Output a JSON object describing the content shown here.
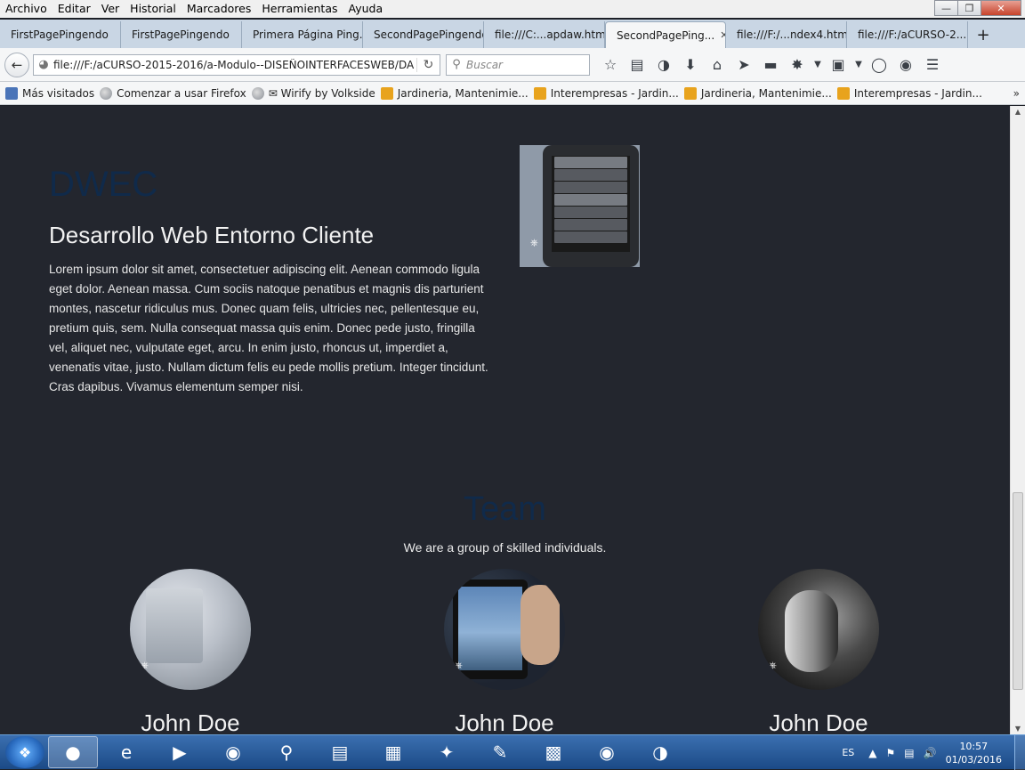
{
  "menubar": {
    "items": [
      "Archivo",
      "Editar",
      "Ver",
      "Historial",
      "Marcadores",
      "Herramientas",
      "Ayuda"
    ]
  },
  "tabs": [
    {
      "label": "FirstPagePingendo",
      "active": false
    },
    {
      "label": "FirstPagePingendo",
      "active": false
    },
    {
      "label": "Primera Página Ping...",
      "active": false
    },
    {
      "label": "SecondPagePingendo",
      "active": false
    },
    {
      "label": "file:///C:...apdaw.html",
      "active": false
    },
    {
      "label": "SecondPagePing...",
      "active": true
    },
    {
      "label": "file:///F:/...ndex4.html",
      "active": false
    },
    {
      "label": "file:///F:/aCURSO-2...",
      "active": false
    }
  ],
  "navbar": {
    "url": "file:///F:/aCURSO-2015-2016/a-Modulo--DISEÑOINTERFACESWEB/DA",
    "search_placeholder": "Buscar"
  },
  "bookmarks": [
    {
      "label": "Más visitados",
      "icon": "star"
    },
    {
      "label": "Comenzar a usar Firefox",
      "icon": "glob"
    },
    {
      "label": "✉ Wirify by Volkside",
      "icon": "glob"
    },
    {
      "label": "Jardineria, Mantenimie...",
      "icon": "rss"
    },
    {
      "label": "Interempresas - Jardin...",
      "icon": "rss"
    },
    {
      "label": "Jardineria, Mantenimie...",
      "icon": "rss"
    },
    {
      "label": "Interempresas - Jardin...",
      "icon": "rss"
    }
  ],
  "content": {
    "dwec_title": "DWEC",
    "dwec_subtitle": "Desarrollo Web Entorno Cliente",
    "dwec_body": "Lorem ipsum dolor sit amet, consectetuer adipiscing elit. Aenean commodo ligula eget dolor. Aenean massa. Cum sociis natoque penatibus et magnis dis parturient montes, nascetur ridiculus mus. Donec quam felis, ultricies nec, pellentesque eu, pretium quis, sem. Nulla consequat massa quis enim. Donec pede justo, fringilla vel, aliquet nec, vulputate eget, arcu. In enim justo, rhoncus ut, imperdiet a, venenatis vitae, justo. Nullam dictum felis eu pede mollis pretium. Integer tincidunt. Cras dapibus. Vivamus elementum semper nisi.",
    "team_title": "Team",
    "team_subtitle": "We are a group of skilled individuals.",
    "members": [
      {
        "name": "John Doe"
      },
      {
        "name": "John Doe"
      },
      {
        "name": "John Doe"
      }
    ]
  },
  "taskbar": {
    "language": "ES",
    "time": "10:57",
    "date": "01/03/2016"
  },
  "colors": {
    "page_bg": "#23262e",
    "heading_dark_blue": "#102a4a",
    "taskbar": "#1b4a86"
  }
}
